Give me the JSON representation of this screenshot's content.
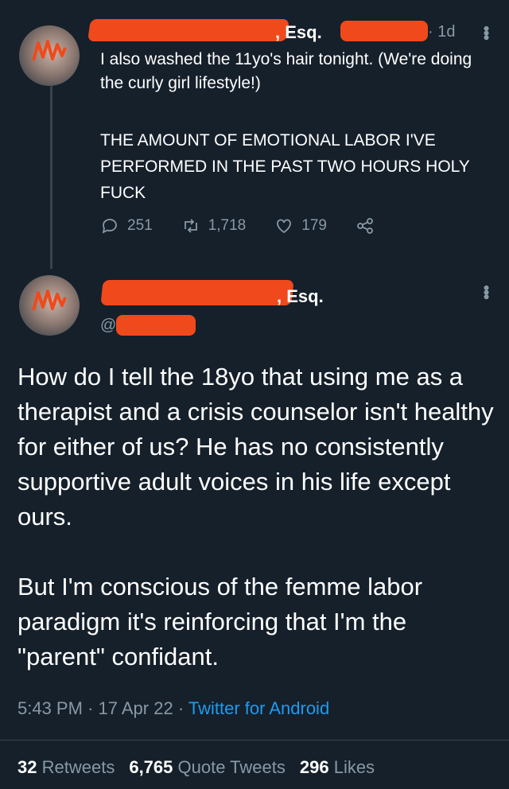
{
  "reply": {
    "name_suffix": ", Esq.",
    "time": "· 1d",
    "more": "⋮",
    "text1": "I also washed the 11yo's hair tonight. (We're doing the curly girl lifestyle!)",
    "text2": "THE AMOUNT OF EMOTIONAL LABOR I'VE PERFORMED IN THE PAST TWO HOURS HOLY FUCK",
    "replies": "251",
    "retweets": "1,718",
    "likes": "179"
  },
  "tweet": {
    "name_suffix": ", Esq.",
    "handle_prefix": "@",
    "more": "⋮",
    "para1": "How do I tell the 18yo that using me as a therapist and a crisis counselor isn't healthy for either of us? He has no consistently supportive adult voices in his life except ours.",
    "para2": "But I'm conscious of the femme labor paradigm it's reinforcing that I'm the \"parent\" confidant.",
    "time": "5:43 PM",
    "date": "17 Apr 22",
    "source": "Twitter for Android",
    "retweets_count": "32",
    "retweets_label": "Retweets",
    "quotes_count": "6,765",
    "quotes_label": "Quote Tweets",
    "likes_count": "296",
    "likes_label": "Likes"
  },
  "colors": {
    "background": "#15202b",
    "muted": "#8899a6",
    "link": "#1d9bf0",
    "redaction": "#f0491c"
  }
}
